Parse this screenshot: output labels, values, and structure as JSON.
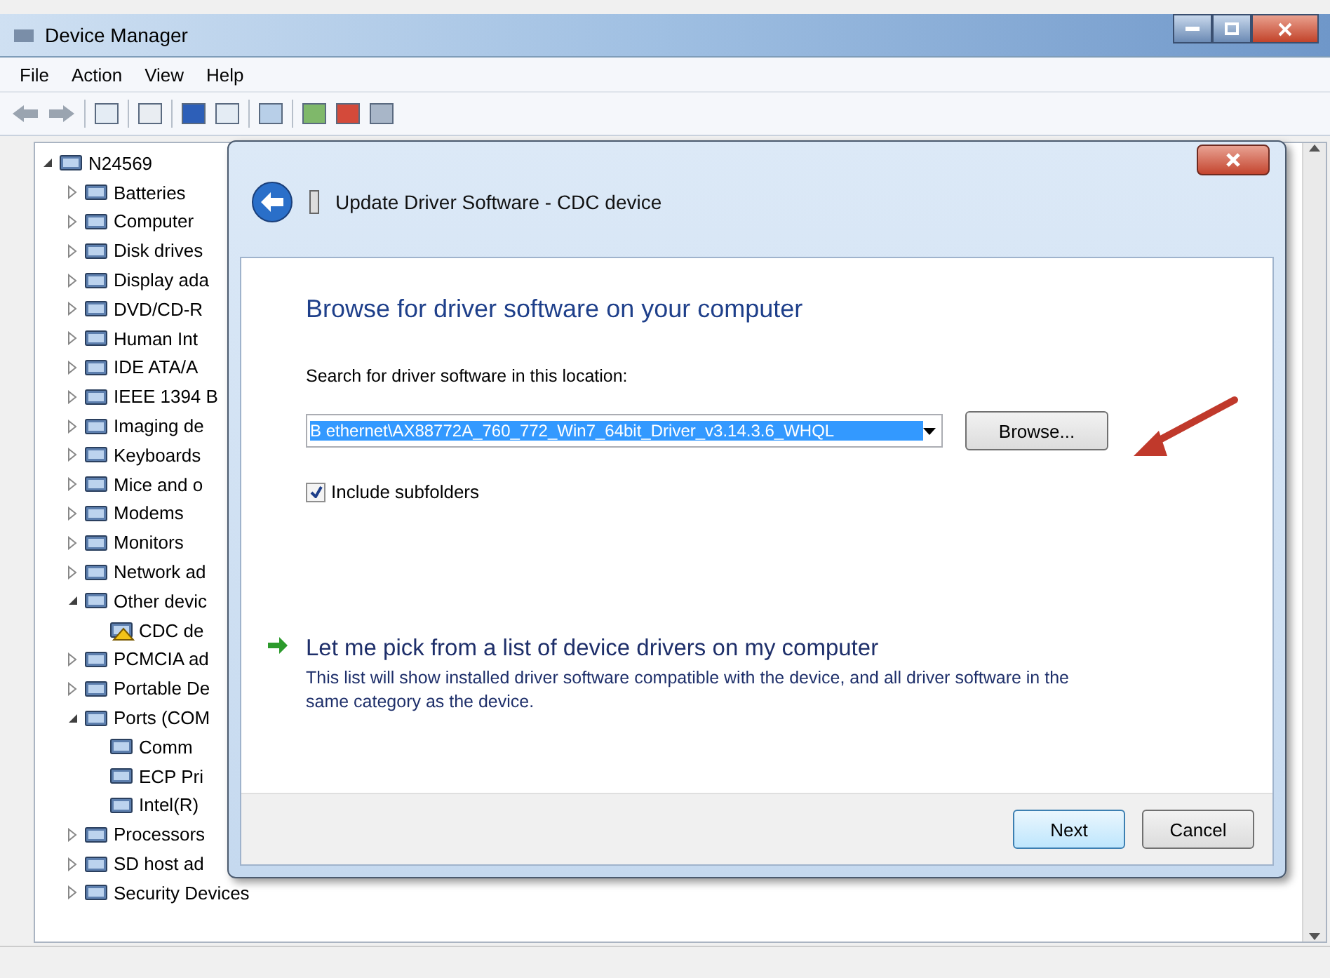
{
  "window": {
    "title": "Device Manager"
  },
  "menu": [
    {
      "label": "File"
    },
    {
      "label": "Action"
    },
    {
      "label": "View"
    },
    {
      "label": "Help"
    }
  ],
  "tree": {
    "label": "N24569",
    "expanded": true,
    "children": [
      {
        "label": "Batteries",
        "expanded": false
      },
      {
        "label": "Computer",
        "expanded": false
      },
      {
        "label": "Disk drives",
        "expanded": false
      },
      {
        "label": "Display ada",
        "expanded": false
      },
      {
        "label": "DVD/CD-R",
        "expanded": false
      },
      {
        "label": "Human Int",
        "expanded": false
      },
      {
        "label": "IDE ATA/A",
        "expanded": false
      },
      {
        "label": "IEEE 1394 B",
        "expanded": false
      },
      {
        "label": "Imaging de",
        "expanded": false
      },
      {
        "label": "Keyboards",
        "expanded": false
      },
      {
        "label": "Mice and o",
        "expanded": false
      },
      {
        "label": "Modems",
        "expanded": false
      },
      {
        "label": "Monitors",
        "expanded": false
      },
      {
        "label": "Network ad",
        "expanded": false
      },
      {
        "label": "Other devic",
        "expanded": true,
        "children": [
          {
            "label": "CDC de",
            "kind": "warning"
          }
        ]
      },
      {
        "label": "PCMCIA ad",
        "expanded": false
      },
      {
        "label": "Portable De",
        "expanded": false
      },
      {
        "label": "Ports (COM",
        "expanded": true,
        "children": [
          {
            "label": "Comm"
          },
          {
            "label": "ECP Pri"
          },
          {
            "label": "Intel(R)"
          }
        ]
      },
      {
        "label": "Processors",
        "expanded": false
      },
      {
        "label": "SD host ad",
        "expanded": false
      },
      {
        "label": "Security Devices",
        "expanded": false
      }
    ]
  },
  "dialog": {
    "title": "Update Driver Software - CDC device",
    "heading": "Browse for driver software on your computer",
    "location_label": "Search for driver software in this location:",
    "path": "B ethernet\\AX88772A_760_772_Win7_64bit_Driver_v3.14.3.6_WHQL",
    "path_selected": true,
    "browse": "Browse...",
    "include_subfolders": {
      "label": "Include subfolders",
      "checked": true
    },
    "pick_link": "Let me pick from a list of device drivers on my computer",
    "pick_desc": "This list will show installed driver software compatible with the device, and all driver software in the same category as the device.",
    "buttons": [
      {
        "label": "Next",
        "default": true
      },
      {
        "label": "Cancel",
        "default": false
      }
    ]
  }
}
